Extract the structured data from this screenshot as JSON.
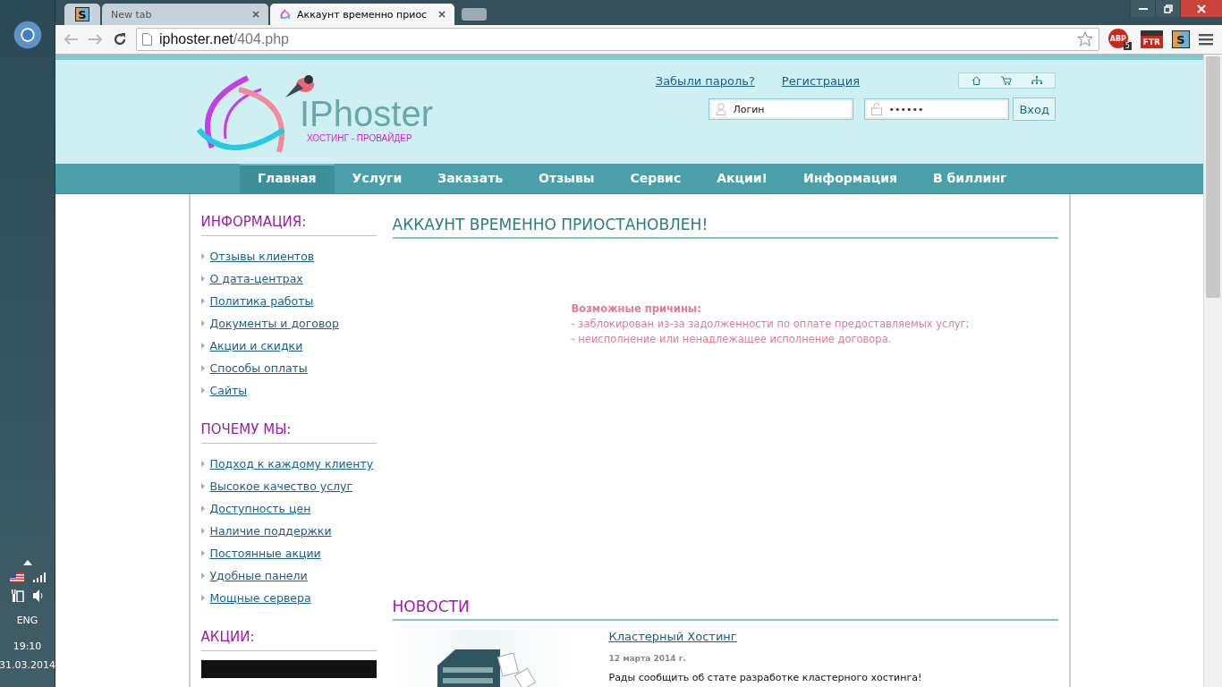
{
  "taskbar": {
    "language": "ENG",
    "time": "19:10",
    "date": "31.03.2014"
  },
  "browser": {
    "tabs": [
      {
        "kind": "pinned",
        "label": "S",
        "selected": false
      },
      {
        "kind": "page",
        "label": "New tab",
        "selected": false
      },
      {
        "kind": "page",
        "label": "Аккаунт временно приос",
        "selected": true
      }
    ],
    "address": {
      "domain": "iphoster.net",
      "path": "/404.php"
    },
    "extensions": {
      "abp_label": "ABP",
      "abp_count": "5",
      "ftr_label": "FTR",
      "s_label": "S"
    }
  },
  "header": {
    "logo": {
      "name": "IPhoster",
      "tagline": "ХОСТИНГ - ПРОВАЙДЕР"
    },
    "links": [
      "Забыли пароль?",
      "Регистрация"
    ],
    "login": {
      "placeholder": "Логин"
    },
    "password": {
      "value": "••••••"
    },
    "submit": "Вход"
  },
  "nav": [
    {
      "label": "Главная",
      "selected": true
    },
    {
      "label": "Услуги",
      "selected": false
    },
    {
      "label": "Заказать",
      "selected": false
    },
    {
      "label": "Отзывы",
      "selected": false
    },
    {
      "label": "Сервис",
      "selected": false
    },
    {
      "label": "Акции!",
      "selected": false
    },
    {
      "label": "Информация",
      "selected": false
    },
    {
      "label": "В биллинг",
      "selected": false
    }
  ],
  "sidebar": [
    {
      "title": "ИНФОРМАЦИЯ:",
      "items": [
        "Отзывы клиентов",
        "О дата-центрах",
        "Политика работы",
        "Документы и договор",
        "Акции и скидки",
        "Способы оплаты",
        "Сайты"
      ]
    },
    {
      "title": "ПОЧЕМУ МЫ:",
      "items": [
        "Подход к каждому клиенту",
        "Высокое качество услуг",
        "Доступность цен",
        "Наличие поддержки",
        "Постоянные акции",
        "Удобные панели",
        "Мощные сервера"
      ]
    },
    {
      "title": "АКЦИИ:"
    }
  ],
  "main": {
    "title": "АККАУНТ ВРЕМЕННО ПРИОСТАНОВЛЕН!",
    "reasons_heading": "Возможные причины:",
    "reasons": [
      "- заблокирован из-за задолженности по оплате предоставляемых услуг;",
      "- неисполнение или ненадлежащее исполнение договора."
    ]
  },
  "news": {
    "title": "НОВОСТИ",
    "items": [
      {
        "title": "Кластерный Хостинг",
        "date": "12 марта 2014 г.",
        "text": "Рады сообщить об стате разработке кластерного хостинга!"
      }
    ]
  }
}
